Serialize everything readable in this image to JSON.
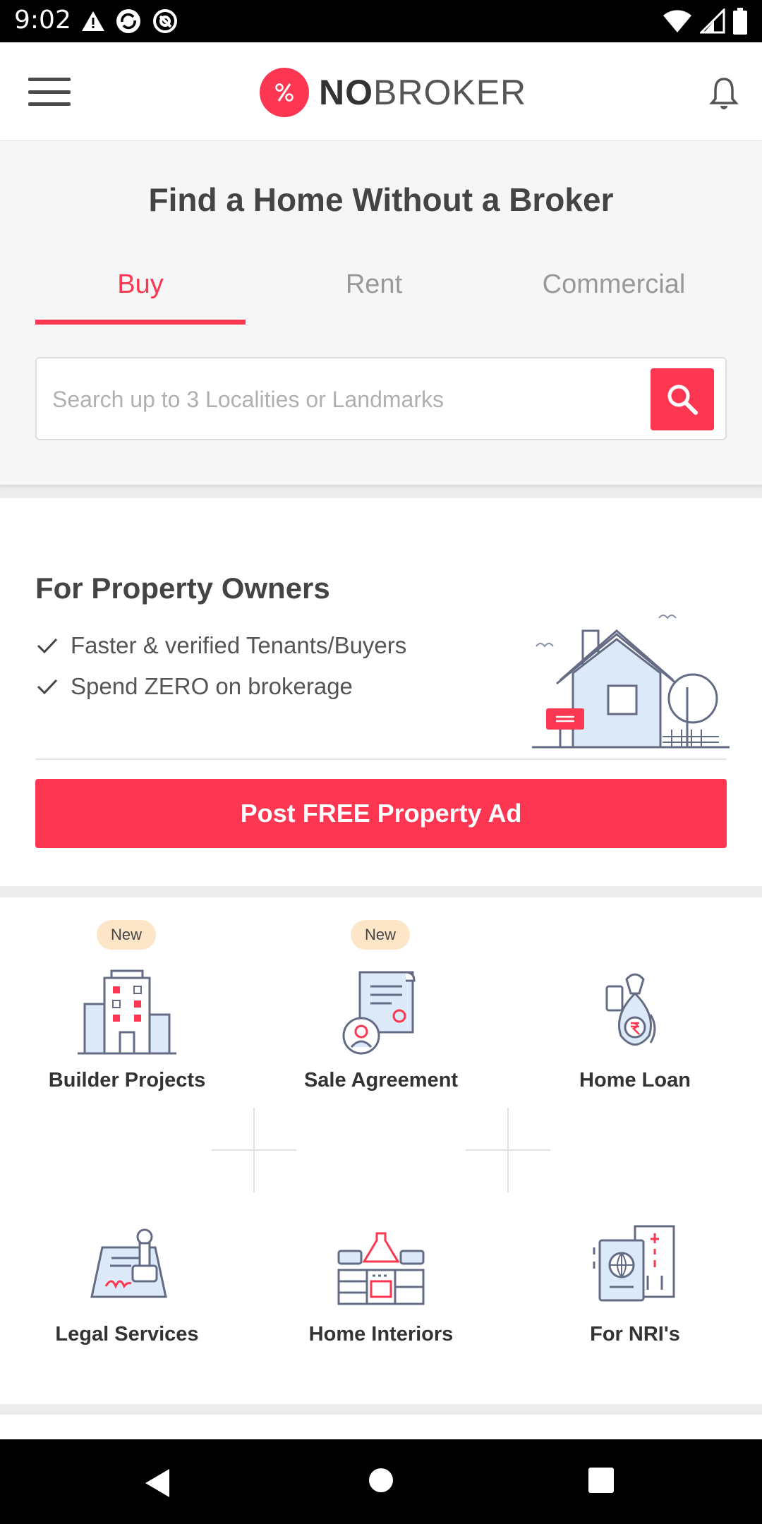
{
  "status": {
    "time": "9:02"
  },
  "header": {
    "brand_bold": "NO",
    "brand_light": "BROKER"
  },
  "search": {
    "title": "Find a Home Without a Broker",
    "tabs": [
      {
        "label": "Buy",
        "active": true
      },
      {
        "label": "Rent",
        "active": false
      },
      {
        "label": "Commercial",
        "active": false
      }
    ],
    "placeholder": "Search up to 3 Localities or Landmarks"
  },
  "owners": {
    "title": "For Property Owners",
    "points": [
      "Faster & verified Tenants/Buyers",
      "Spend ZERO on brokerage"
    ],
    "cta": "Post FREE Property Ad"
  },
  "services": [
    {
      "label": "Builder Projects",
      "badge": "New",
      "icon": "building-icon"
    },
    {
      "label": "Sale Agreement",
      "badge": "New",
      "icon": "agreement-icon"
    },
    {
      "label": "Home Loan",
      "badge": "",
      "icon": "money-bag-icon"
    },
    {
      "label": "Legal Services",
      "badge": "",
      "icon": "stamp-icon"
    },
    {
      "label": "Home Interiors",
      "badge": "",
      "icon": "interiors-icon"
    },
    {
      "label": "For NRI's",
      "badge": "",
      "icon": "passport-icon"
    }
  ],
  "colors": {
    "brand": "#fd3752",
    "badge_bg": "#fde5c8"
  }
}
